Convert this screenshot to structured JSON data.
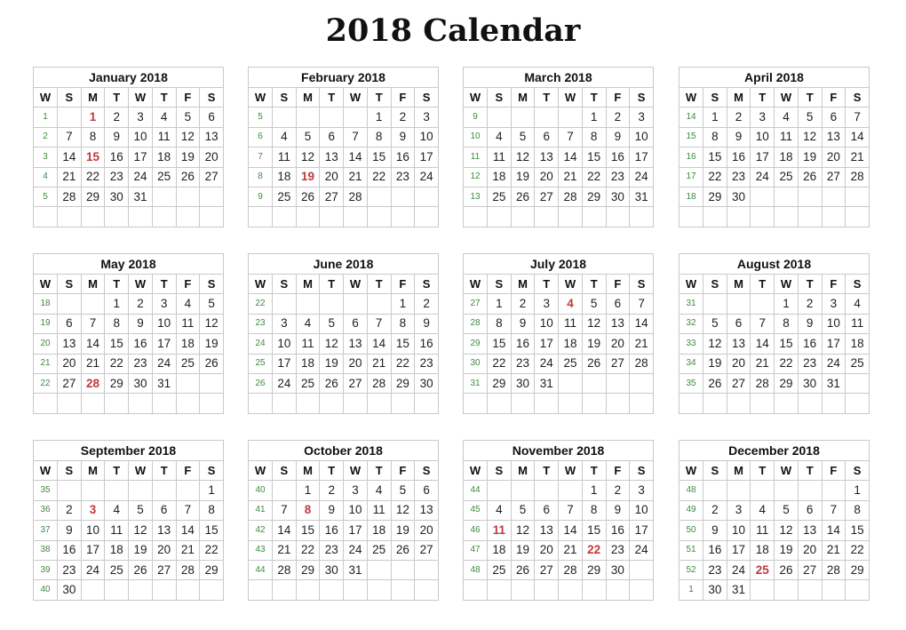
{
  "title": "2018 Calendar",
  "colors": {
    "holiday": "#c0393b",
    "week_number": "#3c8b3c",
    "grid": "#c9c9c9"
  },
  "day_headers": [
    "W",
    "S",
    "M",
    "T",
    "W",
    "T",
    "F",
    "S"
  ],
  "months": [
    {
      "name": "January 2018",
      "rows": [
        [
          "1",
          "",
          "1",
          "2",
          "3",
          "4",
          "5",
          "6"
        ],
        [
          "2",
          "7",
          "8",
          "9",
          "10",
          "11",
          "12",
          "13"
        ],
        [
          "3",
          "14",
          "15",
          "16",
          "17",
          "18",
          "19",
          "20"
        ],
        [
          "4",
          "21",
          "22",
          "23",
          "24",
          "25",
          "26",
          "27"
        ],
        [
          "5",
          "28",
          "29",
          "30",
          "31",
          "",
          "",
          ""
        ],
        [
          "",
          "",
          "",
          "",
          "",
          "",
          "",
          ""
        ]
      ],
      "holidays": [
        "1",
        "15"
      ]
    },
    {
      "name": "February 2018",
      "rows": [
        [
          "5",
          "",
          "",
          "",
          "",
          "1",
          "2",
          "3"
        ],
        [
          "6",
          "4",
          "5",
          "6",
          "7",
          "8",
          "9",
          "10"
        ],
        [
          "7",
          "11",
          "12",
          "13",
          "14",
          "15",
          "16",
          "17"
        ],
        [
          "8",
          "18",
          "19",
          "20",
          "21",
          "22",
          "23",
          "24"
        ],
        [
          "9",
          "25",
          "26",
          "27",
          "28",
          "",
          "",
          ""
        ],
        [
          "",
          "",
          "",
          "",
          "",
          "",
          "",
          ""
        ]
      ],
      "holidays": [
        "19"
      ]
    },
    {
      "name": "March 2018",
      "rows": [
        [
          "9",
          "",
          "",
          "",
          "",
          "1",
          "2",
          "3"
        ],
        [
          "10",
          "4",
          "5",
          "6",
          "7",
          "8",
          "9",
          "10"
        ],
        [
          "11",
          "11",
          "12",
          "13",
          "14",
          "15",
          "16",
          "17"
        ],
        [
          "12",
          "18",
          "19",
          "20",
          "21",
          "22",
          "23",
          "24"
        ],
        [
          "13",
          "25",
          "26",
          "27",
          "28",
          "29",
          "30",
          "31"
        ],
        [
          "",
          "",
          "",
          "",
          "",
          "",
          "",
          ""
        ]
      ],
      "holidays": []
    },
    {
      "name": "April 2018",
      "rows": [
        [
          "14",
          "1",
          "2",
          "3",
          "4",
          "5",
          "6",
          "7"
        ],
        [
          "15",
          "8",
          "9",
          "10",
          "11",
          "12",
          "13",
          "14"
        ],
        [
          "16",
          "15",
          "16",
          "17",
          "18",
          "19",
          "20",
          "21"
        ],
        [
          "17",
          "22",
          "23",
          "24",
          "25",
          "26",
          "27",
          "28"
        ],
        [
          "18",
          "29",
          "30",
          "",
          "",
          "",
          "",
          ""
        ],
        [
          "",
          "",
          "",
          "",
          "",
          "",
          "",
          ""
        ]
      ],
      "holidays": []
    },
    {
      "name": "May 2018",
      "rows": [
        [
          "18",
          "",
          "",
          "1",
          "2",
          "3",
          "4",
          "5"
        ],
        [
          "19",
          "6",
          "7",
          "8",
          "9",
          "10",
          "11",
          "12"
        ],
        [
          "20",
          "13",
          "14",
          "15",
          "16",
          "17",
          "18",
          "19"
        ],
        [
          "21",
          "20",
          "21",
          "22",
          "23",
          "24",
          "25",
          "26"
        ],
        [
          "22",
          "27",
          "28",
          "29",
          "30",
          "31",
          "",
          ""
        ],
        [
          "",
          "",
          "",
          "",
          "",
          "",
          "",
          ""
        ]
      ],
      "holidays": [
        "28"
      ]
    },
    {
      "name": "June 2018",
      "rows": [
        [
          "22",
          "",
          "",
          "",
          "",
          "",
          "1",
          "2"
        ],
        [
          "23",
          "3",
          "4",
          "5",
          "6",
          "7",
          "8",
          "9"
        ],
        [
          "24",
          "10",
          "11",
          "12",
          "13",
          "14",
          "15",
          "16"
        ],
        [
          "25",
          "17",
          "18",
          "19",
          "20",
          "21",
          "22",
          "23"
        ],
        [
          "26",
          "24",
          "25",
          "26",
          "27",
          "28",
          "29",
          "30"
        ],
        [
          "",
          "",
          "",
          "",
          "",
          "",
          "",
          ""
        ]
      ],
      "holidays": []
    },
    {
      "name": "July 2018",
      "rows": [
        [
          "27",
          "1",
          "2",
          "3",
          "4",
          "5",
          "6",
          "7"
        ],
        [
          "28",
          "8",
          "9",
          "10",
          "11",
          "12",
          "13",
          "14"
        ],
        [
          "29",
          "15",
          "16",
          "17",
          "18",
          "19",
          "20",
          "21"
        ],
        [
          "30",
          "22",
          "23",
          "24",
          "25",
          "26",
          "27",
          "28"
        ],
        [
          "31",
          "29",
          "30",
          "31",
          "",
          "",
          "",
          ""
        ],
        [
          "",
          "",
          "",
          "",
          "",
          "",
          "",
          ""
        ]
      ],
      "holidays": [
        "4"
      ]
    },
    {
      "name": "August 2018",
      "rows": [
        [
          "31",
          "",
          "",
          "",
          "1",
          "2",
          "3",
          "4"
        ],
        [
          "32",
          "5",
          "6",
          "7",
          "8",
          "9",
          "10",
          "11"
        ],
        [
          "33",
          "12",
          "13",
          "14",
          "15",
          "16",
          "17",
          "18"
        ],
        [
          "34",
          "19",
          "20",
          "21",
          "22",
          "23",
          "24",
          "25"
        ],
        [
          "35",
          "26",
          "27",
          "28",
          "29",
          "30",
          "31",
          ""
        ],
        [
          "",
          "",
          "",
          "",
          "",
          "",
          "",
          ""
        ]
      ],
      "holidays": []
    },
    {
      "name": "September 2018",
      "rows": [
        [
          "35",
          "",
          "",
          "",
          "",
          "",
          "",
          "1"
        ],
        [
          "36",
          "2",
          "3",
          "4",
          "5",
          "6",
          "7",
          "8"
        ],
        [
          "37",
          "9",
          "10",
          "11",
          "12",
          "13",
          "14",
          "15"
        ],
        [
          "38",
          "16",
          "17",
          "18",
          "19",
          "20",
          "21",
          "22"
        ],
        [
          "39",
          "23",
          "24",
          "25",
          "26",
          "27",
          "28",
          "29"
        ],
        [
          "40",
          "30",
          "",
          "",
          "",
          "",
          "",
          ""
        ]
      ],
      "holidays": [
        "3"
      ]
    },
    {
      "name": "October 2018",
      "rows": [
        [
          "40",
          "",
          "1",
          "2",
          "3",
          "4",
          "5",
          "6"
        ],
        [
          "41",
          "7",
          "8",
          "9",
          "10",
          "11",
          "12",
          "13"
        ],
        [
          "42",
          "14",
          "15",
          "16",
          "17",
          "18",
          "19",
          "20"
        ],
        [
          "43",
          "21",
          "22",
          "23",
          "24",
          "25",
          "26",
          "27"
        ],
        [
          "44",
          "28",
          "29",
          "30",
          "31",
          "",
          "",
          ""
        ],
        [
          "",
          "",
          "",
          "",
          "",
          "",
          "",
          ""
        ]
      ],
      "holidays": [
        "8"
      ]
    },
    {
      "name": "November 2018",
      "rows": [
        [
          "44",
          "",
          "",
          "",
          "",
          "1",
          "2",
          "3"
        ],
        [
          "45",
          "4",
          "5",
          "6",
          "7",
          "8",
          "9",
          "10"
        ],
        [
          "46",
          "11",
          "12",
          "13",
          "14",
          "15",
          "16",
          "17"
        ],
        [
          "47",
          "18",
          "19",
          "20",
          "21",
          "22",
          "23",
          "24"
        ],
        [
          "48",
          "25",
          "26",
          "27",
          "28",
          "29",
          "30",
          ""
        ],
        [
          "",
          "",
          "",
          "",
          "",
          "",
          "",
          ""
        ]
      ],
      "holidays": [
        "11",
        "22"
      ]
    },
    {
      "name": "December 2018",
      "rows": [
        [
          "48",
          "",
          "",
          "",
          "",
          "",
          "",
          "1"
        ],
        [
          "49",
          "2",
          "3",
          "4",
          "5",
          "6",
          "7",
          "8"
        ],
        [
          "50",
          "9",
          "10",
          "11",
          "12",
          "13",
          "14",
          "15"
        ],
        [
          "51",
          "16",
          "17",
          "18",
          "19",
          "20",
          "21",
          "22"
        ],
        [
          "52",
          "23",
          "24",
          "25",
          "26",
          "27",
          "28",
          "29"
        ],
        [
          "1",
          "30",
          "31",
          "",
          "",
          "",
          "",
          ""
        ]
      ],
      "holidays": [
        "25"
      ]
    }
  ]
}
